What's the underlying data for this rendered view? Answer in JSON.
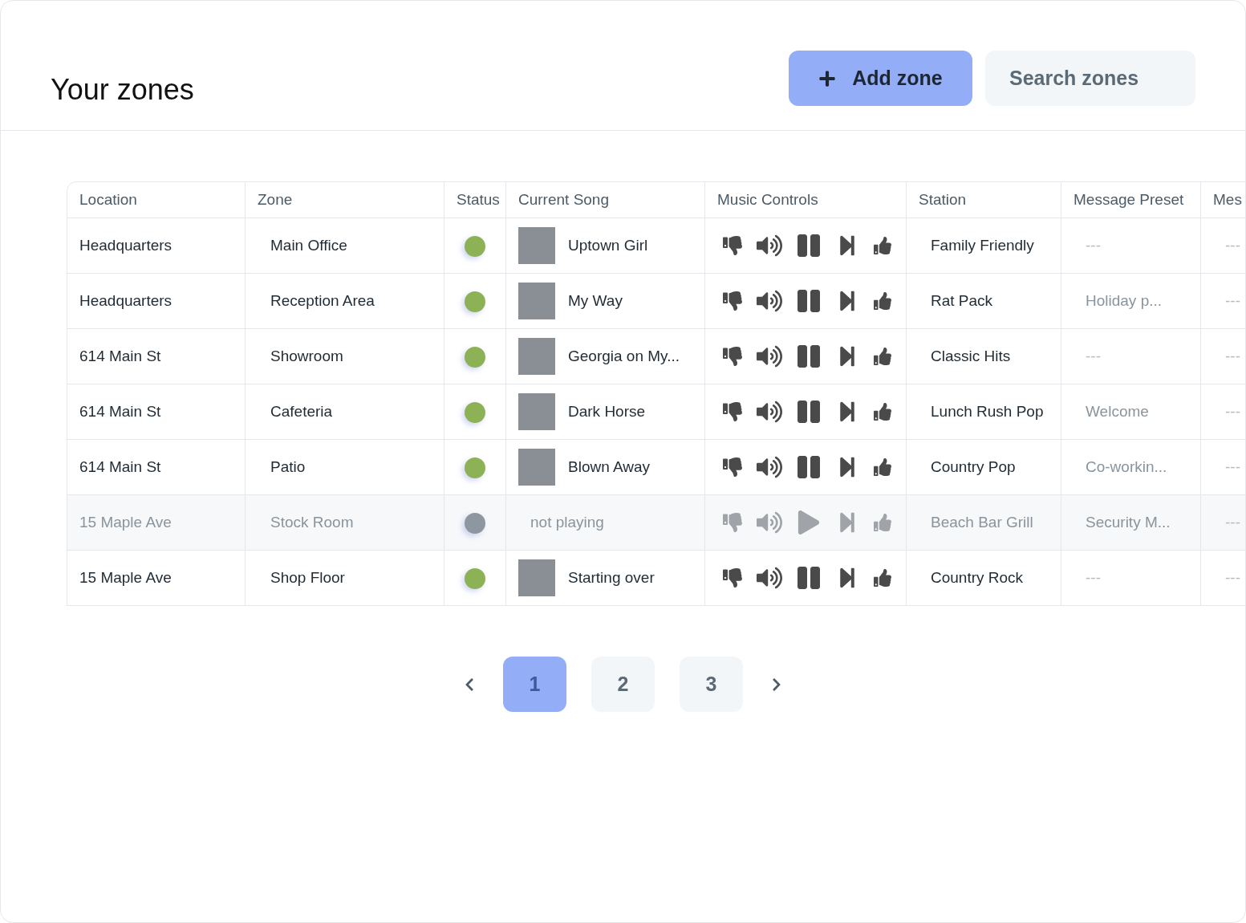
{
  "header": {
    "title": "Your zones",
    "add_button": "Add zone",
    "search": {
      "placeholder": "Search zones"
    }
  },
  "table": {
    "columns": [
      "Location",
      "Zone",
      "Status",
      "Current Song",
      "Music Controls",
      "Station",
      "Message Preset",
      "Mes"
    ],
    "rows": [
      {
        "location": "Headquarters",
        "zone": "Main Office",
        "online": true,
        "song": {
          "title": "Uptown Girl",
          "cover": true
        },
        "playing": true,
        "station": "Family Friendly",
        "preset": {
          "text": "---",
          "set": false
        },
        "column_8": "---"
      },
      {
        "location": "Headquarters",
        "zone": "Reception Area",
        "online": true,
        "song": {
          "title": "My Way",
          "cover": true
        },
        "playing": true,
        "station": "Rat Pack",
        "preset": {
          "text": "Holiday p...",
          "set": true
        },
        "column_8": "---"
      },
      {
        "location": "614 Main St",
        "zone": "Showroom",
        "online": true,
        "song": {
          "title": "Georgia on My...",
          "cover": true
        },
        "playing": true,
        "station": "Classic Hits",
        "preset": {
          "text": "---",
          "set": false
        },
        "column_8": "---"
      },
      {
        "location": "614 Main St",
        "zone": "Cafeteria",
        "online": true,
        "song": {
          "title": "Dark Horse",
          "cover": true
        },
        "playing": true,
        "station": "Lunch Rush Pop",
        "preset": {
          "text": "Welcome",
          "set": true
        },
        "column_8": "---"
      },
      {
        "location": "614 Main St",
        "zone": "Patio",
        "online": true,
        "song": {
          "title": "Blown Away",
          "cover": true
        },
        "playing": true,
        "station": "Country Pop",
        "preset": {
          "text": "Co-workin...",
          "set": true
        },
        "column_8": "---"
      },
      {
        "location": "15 Maple Ave",
        "zone": "Stock Room",
        "online": false,
        "song": {
          "title": "not playing",
          "cover": false
        },
        "playing": false,
        "station": "Beach Bar Grill",
        "preset": {
          "text": "Security M...",
          "set": true
        },
        "column_8": "---"
      },
      {
        "location": "15 Maple Ave",
        "zone": "Shop Floor",
        "online": true,
        "song": {
          "title": "Starting over",
          "cover": true
        },
        "playing": true,
        "station": "Country Rock",
        "preset": {
          "text": "---",
          "set": false
        },
        "column_8": "---"
      }
    ]
  },
  "pagination": {
    "pages": [
      {
        "label": "1",
        "selected": true
      },
      {
        "label": "2",
        "selected": false
      },
      {
        "label": "3",
        "selected": false
      }
    ]
  }
}
